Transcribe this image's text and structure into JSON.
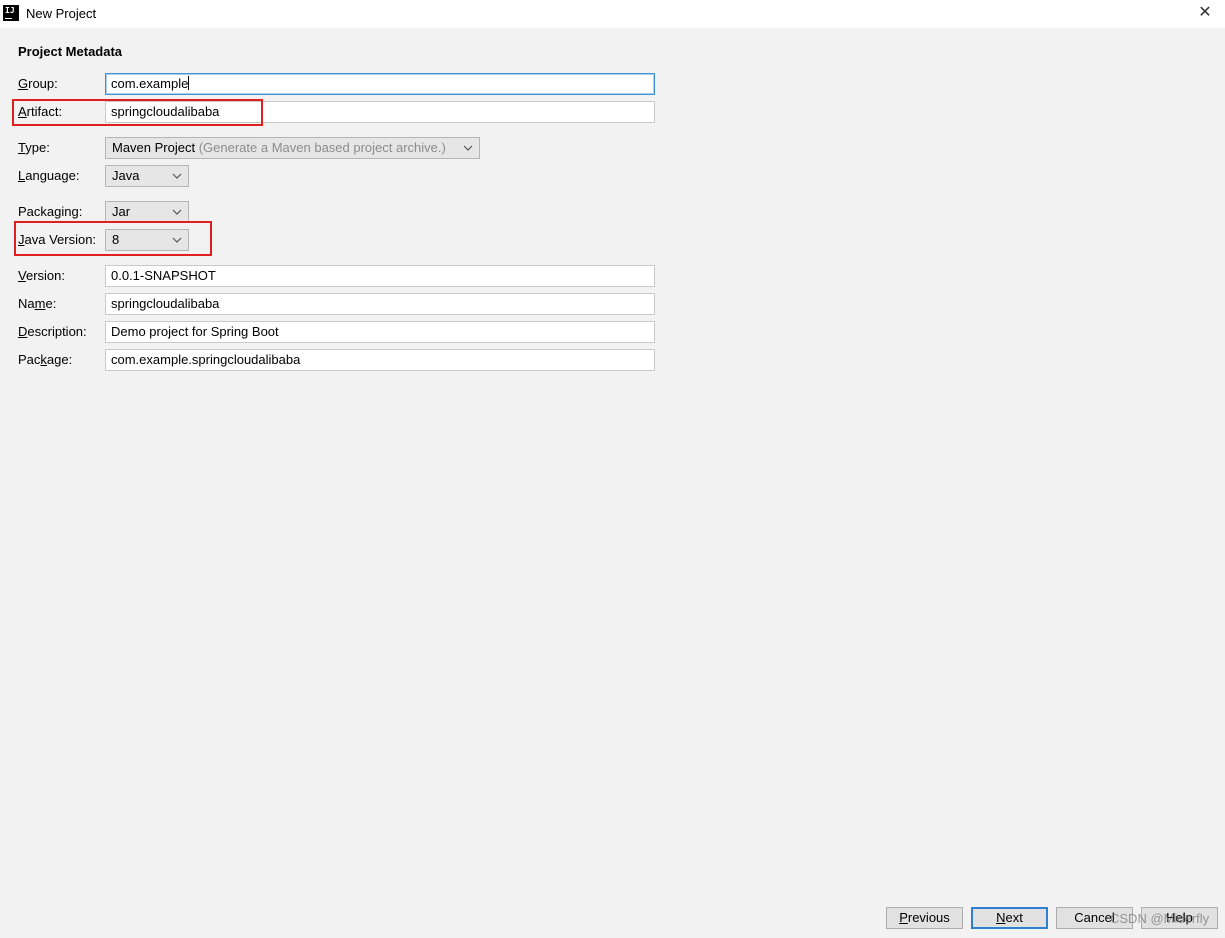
{
  "window": {
    "icon_text": "IJ",
    "title": "New Project",
    "close_glyph": "✕"
  },
  "form": {
    "section_title": "Project Metadata",
    "group": {
      "label_mnemonic": "G",
      "label_rest": "roup:",
      "value": "com.example"
    },
    "artifact": {
      "label_mnemonic": "A",
      "label_rest": "rtifact:",
      "value": "springcloudalibaba"
    },
    "type": {
      "label_mnemonic": "T",
      "label_rest": "ype:",
      "value": "Maven Project",
      "hint": "(Generate a Maven based project archive.)"
    },
    "language": {
      "label_mnemonic": "L",
      "label_rest": "anguage:",
      "value": "Java"
    },
    "packaging": {
      "label_pre": "Packa",
      "label_mnemonic": "g",
      "label_rest": "ing:",
      "value": "Jar"
    },
    "java_version": {
      "label_mnemonic": "J",
      "label_rest": "ava Version:",
      "value": "8"
    },
    "version": {
      "label_mnemonic": "V",
      "label_rest": "ersion:",
      "value": "0.0.1-SNAPSHOT"
    },
    "name": {
      "label_pre": "Na",
      "label_mnemonic": "m",
      "label_rest": "e:",
      "value": "springcloudalibaba"
    },
    "description": {
      "label_mnemonic": "D",
      "label_rest": "escription:",
      "value": "Demo project for Spring Boot"
    },
    "package": {
      "label_pre": "Pac",
      "label_mnemonic": "k",
      "label_rest": "age:",
      "value": "com.example.springcloudalibaba"
    }
  },
  "buttons": {
    "previous": {
      "mnemonic": "P",
      "rest": "revious"
    },
    "next": {
      "mnemonic": "N",
      "rest": "ext"
    },
    "cancel": "Cancel",
    "help": "Help"
  },
  "watermark": "CSDN @Miderfly",
  "colors": {
    "annotation_box": "#e02020",
    "focus_border": "#3d8fd6",
    "default_button_border": "#2f7fd1"
  },
  "icons": {
    "app": "intellij-icon",
    "close": "close-icon",
    "dropdown": "chevron-down-icon"
  }
}
